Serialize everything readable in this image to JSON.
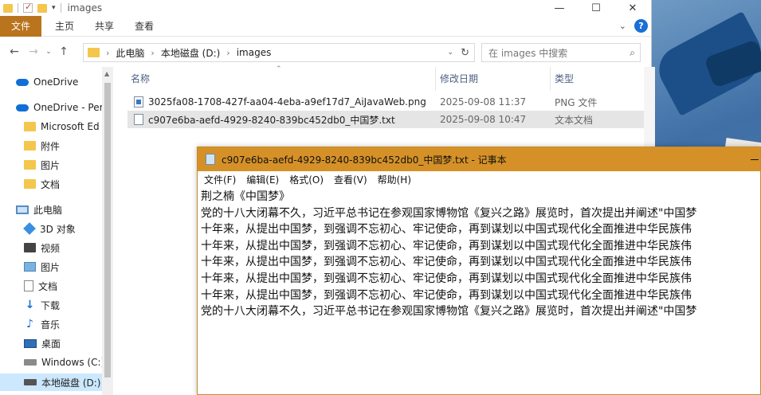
{
  "explorer": {
    "title": "images",
    "window_controls": [
      "—",
      "☐",
      "✕"
    ],
    "ribbon": {
      "file": "文件",
      "tabs": [
        "主页",
        "共享",
        "查看"
      ]
    },
    "nav": {
      "back": "←",
      "forward": "→",
      "recent": "⌄",
      "up": "↑"
    },
    "breadcrumb": [
      "此电脑",
      "本地磁盘 (D:)",
      "images"
    ],
    "search_placeholder": "在 images 中搜索",
    "sidebar": [
      {
        "label": "OneDrive",
        "icon": "cloud"
      },
      {
        "label": "OneDrive - Per",
        "icon": "cloud"
      },
      {
        "label": "Microsoft Ed",
        "icon": "folder"
      },
      {
        "label": "附件",
        "icon": "folder"
      },
      {
        "label": "图片",
        "icon": "folder"
      },
      {
        "label": "文档",
        "icon": "folder"
      },
      {
        "label": "此电脑",
        "icon": "pc"
      },
      {
        "label": "3D 对象",
        "icon": "3d"
      },
      {
        "label": "视频",
        "icon": "video"
      },
      {
        "label": "图片",
        "icon": "picture"
      },
      {
        "label": "文档",
        "icon": "document"
      },
      {
        "label": "下载",
        "icon": "download"
      },
      {
        "label": "音乐",
        "icon": "music"
      },
      {
        "label": "桌面",
        "icon": "desktop"
      },
      {
        "label": "Windows (C:)",
        "icon": "drive"
      },
      {
        "label": "本地磁盘 (D:)",
        "icon": "drive"
      }
    ],
    "columns": {
      "name": "名称",
      "date": "修改日期",
      "type": "类型"
    },
    "files": [
      {
        "name": "3025fa08-1708-427f-aa04-4eba-a9ef17d7_AiJavaWeb.png",
        "date": "2025-09-08 11:37",
        "type": "PNG 文件"
      },
      {
        "name": "c907e6ba-aefd-4929-8240-839bc452db0_中国梦.txt",
        "date": "2025-09-08 10:47",
        "type": "文本文档"
      }
    ]
  },
  "notepad": {
    "title": "c907e6ba-aefd-4929-8240-839bc452db0_中国梦.txt - 记事本",
    "menu": [
      "文件(F)",
      "编辑(E)",
      "格式(O)",
      "查看(V)",
      "帮助(H)"
    ],
    "lines": [
      "荆之楠《中国梦》",
      "党的十八大闭幕不久，习近平总书记在参观国家博物馆《复兴之路》展览时，首次提出并阐述\"中国梦",
      "十年来，从提出中国梦，到强调不忘初心、牢记使命，再到谋划以中国式现代化全面推进中华民族伟",
      "十年来，从提出中国梦，到强调不忘初心、牢记使命，再到谋划以中国式现代化全面推进中华民族伟",
      "十年来，从提出中国梦，到强调不忘初心、牢记使命，再到谋划以中国式现代化全面推进中华民族伟",
      "十年来，从提出中国梦，到强调不忘初心、牢记使命，再到谋划以中国式现代化全面推进中华民族伟",
      "十年来，从提出中国梦，到强调不忘初心、牢记使命，再到谋划以中国式现代化全面推进中华民族伟",
      "党的十八大闭幕不久，习近平总书记在参观国家博物馆《复兴之路》展览时，首次提出并阐述\"中国梦"
    ]
  }
}
